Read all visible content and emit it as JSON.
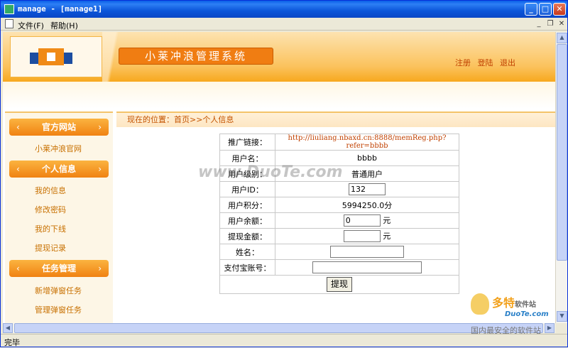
{
  "window": {
    "title": "manage - [manage1]"
  },
  "menu": {
    "file": "文件(F)",
    "help": "帮助(H)"
  },
  "header": {
    "site_title": "小莱冲浪管理系统",
    "links": [
      "注册",
      "登陆",
      "退出"
    ]
  },
  "sidebar": {
    "sections": [
      {
        "title": "官方网站",
        "links": [
          "小莱冲浪官网"
        ]
      },
      {
        "title": "个人信息",
        "links": [
          "我的信息",
          "修改密码",
          "我的下线",
          "提现记录"
        ]
      },
      {
        "title": "任务管理",
        "links": [
          "新增弹窗任务",
          "管理弹窗任务"
        ]
      }
    ],
    "chevron_left": "‹",
    "chevron_right": "›"
  },
  "breadcrumb": "现在的位置：首页>>个人信息",
  "form": {
    "promo_label": "推广链接：",
    "promo_value": "http://liuliang.nbaxd.cn:8888/memReg.php?refer=bbbb",
    "username_label": "用户名：",
    "username_value": "bbbb",
    "level_label": "用户级别：",
    "level_value": "普通用户",
    "userid_label": "用户ID：",
    "userid_value": "132",
    "points_label": "用户积分：",
    "points_value": "5994250.0分",
    "balance_label": "用户余额：",
    "balance_value": "0",
    "yuan": "元",
    "withdraw_label": "提现金额：",
    "withdraw_value": "",
    "name_label": "姓名：",
    "name_value": "",
    "alipay_label": "支付宝账号：",
    "alipay_value": "",
    "submit_label": "提现"
  },
  "watermark": "www.DuoTe.com",
  "brand": {
    "line1": "多特",
    "line1_small": "软件站",
    "line2": "DuoTe.com",
    "line3": "国内最安全的软件站"
  },
  "status": "完毕"
}
